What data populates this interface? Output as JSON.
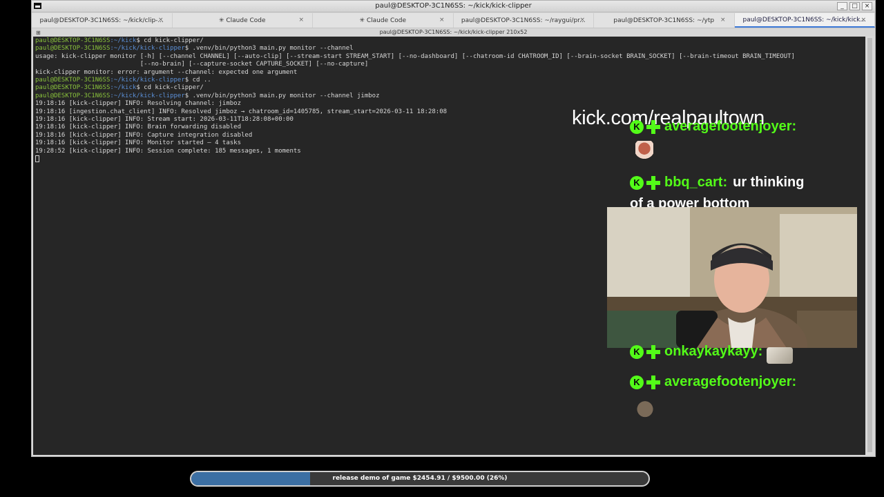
{
  "window": {
    "title": "paul@DESKTOP-3C1N6SS: ~/kick/kick-clipper",
    "buttons": [
      "_",
      "□",
      "×"
    ]
  },
  "tabs": [
    {
      "label": "paul@DESKTOP-3C1N6SS: ~/kick/clip-...",
      "close": "×"
    },
    {
      "label": "✳ Claude Code",
      "close": "×"
    },
    {
      "label": "✳ Claude Code",
      "close": "×"
    },
    {
      "label": "paul@DESKTOP-3C1N6SS: ~/raygui/pr...",
      "close": "×"
    },
    {
      "label": "paul@DESKTOP-3C1N6SS: ~/ytp",
      "close": "×"
    },
    {
      "label": "paul@DESKTOP-3C1N6SS: ~/kick/kick...",
      "close": "×"
    }
  ],
  "infobar": {
    "text": "paul@DESKTOP-3C1N6SS: ~/kick/kick-clipper 210x52"
  },
  "terminal": {
    "lines": [
      {
        "user": "paul@DESKTOP-3C1N6SS",
        "path": ":~/kick",
        "cmd": "$ cd kick-clipper/"
      },
      {
        "user": "paul@DESKTOP-3C1N6SS",
        "path": ":~/kick/kick-clipper",
        "cmd": "$ .venv/bin/python3 main.py monitor --channel"
      },
      {
        "text": "usage: kick-clipper monitor [-h] [--channel CHANNEL] [--auto-clip] [--stream-start STREAM_START] [--no-dashboard] [--chatroom-id CHATROOM_ID] [--brain-socket BRAIN_SOCKET] [--brain-timeout BRAIN_TIMEOUT]"
      },
      {
        "text": "                            [--no-brain] [--capture-socket CAPTURE_SOCKET] [--no-capture]"
      },
      {
        "text": "kick-clipper monitor: error: argument --channel: expected one argument"
      },
      {
        "user": "paul@DESKTOP-3C1N6SS",
        "path": ":~/kick/kick-clipper",
        "cmd": "$ cd .."
      },
      {
        "user": "paul@DESKTOP-3C1N6SS",
        "path": ":~/kick",
        "cmd": "$ cd kick-clipper/"
      },
      {
        "user": "paul@DESKTOP-3C1N6SS",
        "path": ":~/kick/kick-clipper",
        "cmd": "$ .venv/bin/python3 main.py monitor --channel jimboz"
      },
      {
        "text": "19:18:16 [kick-clipper] INFO: Resolving channel: jimboz"
      },
      {
        "text": "19:18:16 [ingestion.chat_client] INFO: Resolved jimboz → chatroom_id=1405785, stream_start=2026-03-11 18:28:08"
      },
      {
        "text": "19:18:16 [kick-clipper] INFO: Stream start: 2026-03-11T18:28:08+00:00"
      },
      {
        "text": "19:18:16 [kick-clipper] INFO: Brain forwarding disabled"
      },
      {
        "text": "19:18:16 [kick-clipper] INFO: Capture integration disabled"
      },
      {
        "text": "19:18:16 [kick-clipper] INFO: Monitor started — 4 tasks"
      },
      {
        "text": "19:28:52 [kick-clipper] INFO: Session complete: 185 messages, 1 moments"
      }
    ]
  },
  "overlay": {
    "title": "kick.com/realpaultown",
    "chat": [
      {
        "user": "averagefootenjoyer:",
        "text": ""
      },
      {
        "user": "bbq_cart:",
        "text": "ur thinking",
        "cont": "of a power bottom"
      },
      {
        "user": "onkaykaykayy:",
        "text": ""
      },
      {
        "user": "averagefootenjoyer:",
        "text": ""
      }
    ],
    "badge_letter": "K",
    "accent_color": "#53fc18"
  },
  "progress": {
    "label": "release demo of game $2454.91 / $9500.00 (26%)",
    "fraction": 0.26
  }
}
